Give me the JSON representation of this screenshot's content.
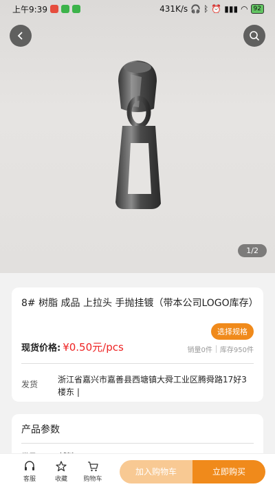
{
  "status_bar": {
    "time": "上午9:39",
    "speed": "431K/s",
    "battery": "92"
  },
  "gallery": {
    "counter": "1/2"
  },
  "product": {
    "title": "8# 树脂 成品 上拉头 手抛挂镀（带本公司LOGO库存）",
    "spec_button": "选择规格",
    "price_label": "现货价格:",
    "price_value": "¥0.50元/pcs",
    "sales": "销量0件",
    "stock": "库存950件",
    "ship_label": "发货",
    "ship_address": "浙江省嘉兴市嘉善县西塘镇大舜工业区腾舜路17好3楼东 |"
  },
  "params": {
    "title": "产品参数",
    "rows": [
      {
        "key": "类目",
        "value": "辅料"
      }
    ]
  },
  "bottom_bar": {
    "service": "客服",
    "favorite": "收藏",
    "cart": "购物车",
    "add_to_cart": "加入购物车",
    "buy_now": "立即购买"
  },
  "colors": {
    "accent": "#f08a1b",
    "accent_light": "#f8c993",
    "price": "#ee2222"
  }
}
